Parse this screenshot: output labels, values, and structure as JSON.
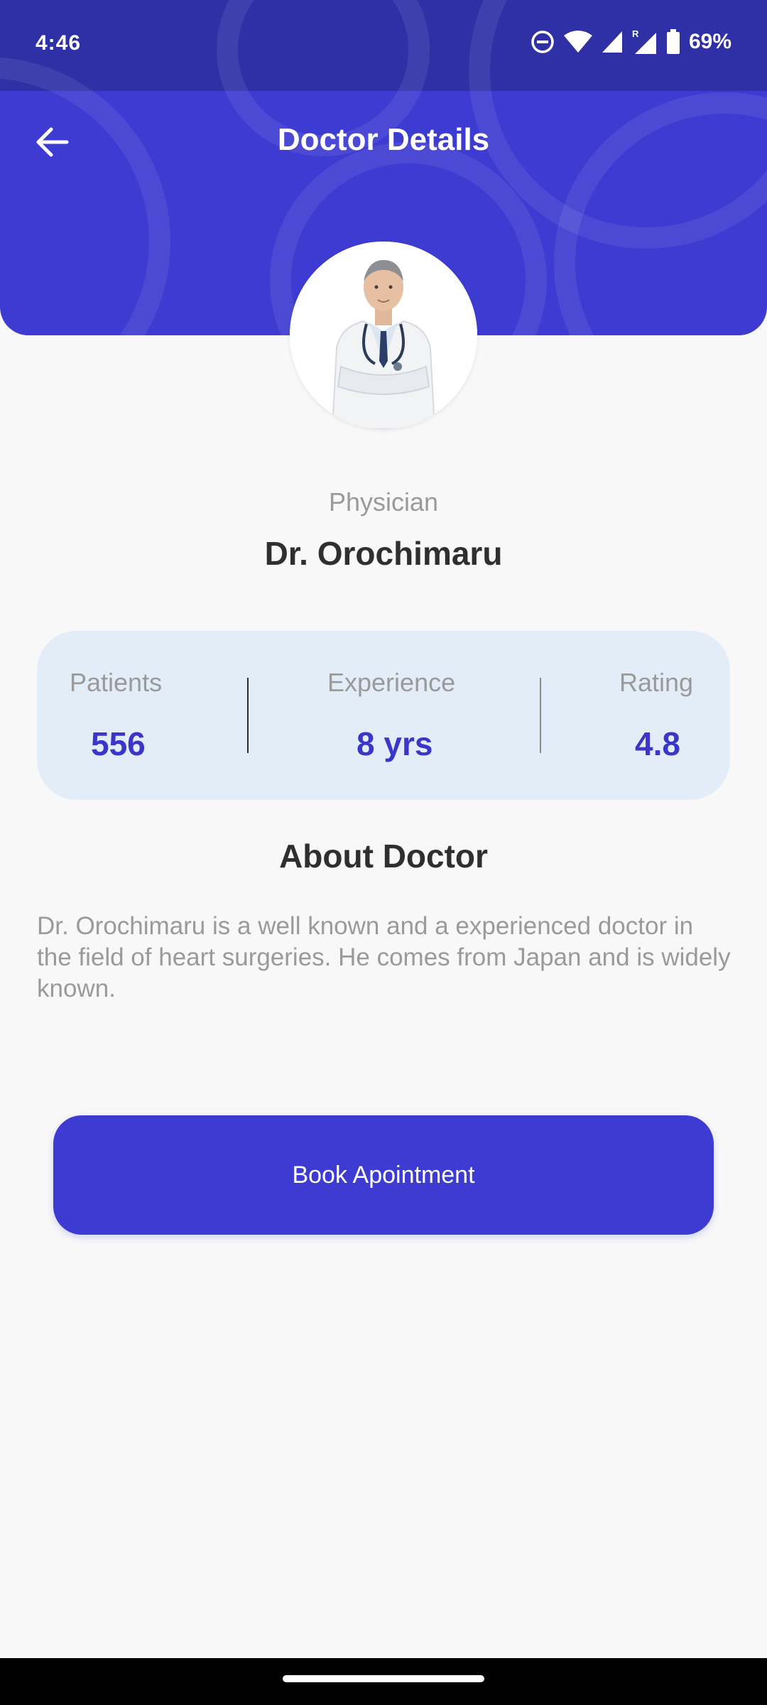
{
  "status_bar": {
    "time": "4:46",
    "battery": "69%",
    "icons": [
      "do-not-disturb-icon",
      "wifi-icon",
      "signal-icon",
      "roaming-signal-icon",
      "battery-icon"
    ]
  },
  "header": {
    "title": "Doctor Details",
    "back_icon": "arrow-left-icon",
    "accent": "#3d3bd1"
  },
  "doctor": {
    "specialty": "Physician",
    "name": "Dr. Orochimaru",
    "photo": "doctor-portrait"
  },
  "stats": [
    {
      "label": "Patients",
      "value": "556"
    },
    {
      "label": "Experience",
      "value": "8 yrs"
    },
    {
      "label": "Rating",
      "value": "4.8"
    }
  ],
  "about": {
    "title": "About Doctor",
    "text": "Dr. Orochimaru is a well known and a experienced doctor in the field of heart surgeries. He comes from Japan and is widely known."
  },
  "actions": {
    "book_label": "Book Apointment"
  }
}
